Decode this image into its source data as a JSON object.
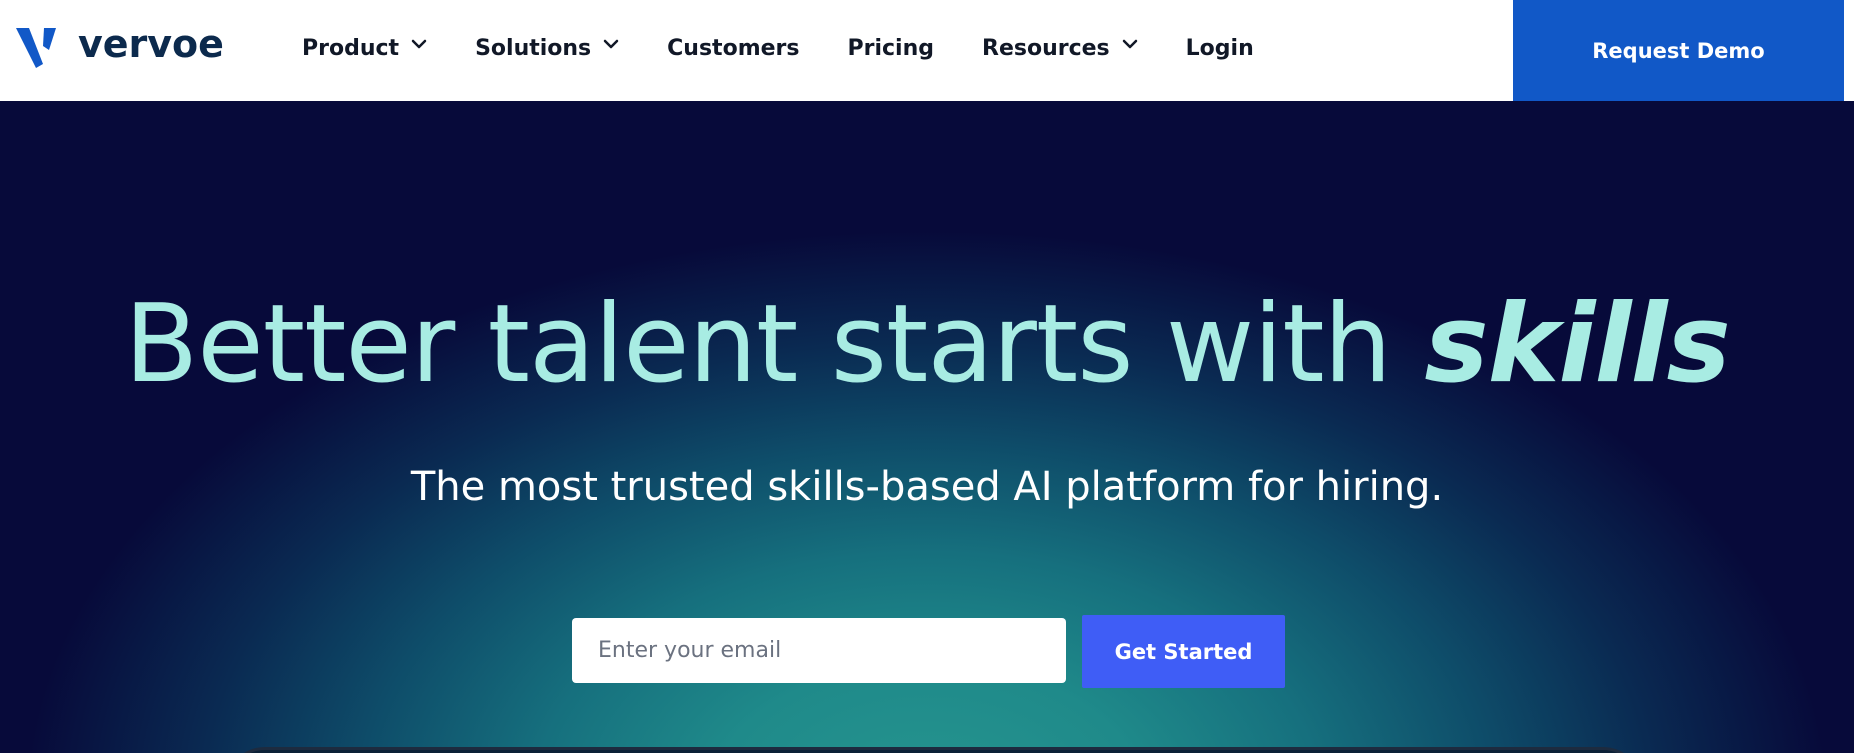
{
  "brand": {
    "name": "vervoe",
    "logo_color": "#1158c7",
    "text_color": "#0c2a4d"
  },
  "nav": {
    "items": [
      {
        "label": "Product",
        "has_dropdown": true
      },
      {
        "label": "Solutions",
        "has_dropdown": true
      },
      {
        "label": "Customers",
        "has_dropdown": false
      },
      {
        "label": "Pricing",
        "has_dropdown": false
      },
      {
        "label": "Resources",
        "has_dropdown": true
      },
      {
        "label": "Login",
        "has_dropdown": false
      }
    ],
    "cta_label": "Request Demo",
    "cta_color": "#1158c7"
  },
  "hero": {
    "headline_main": "Better talent starts with ",
    "headline_emphasis": "skills",
    "subheadline": "The most trusted skills-based AI platform for hiring.",
    "email_placeholder": "Enter your email",
    "email_value": "",
    "cta_label": "Get Started",
    "cta_color": "#3f5df6",
    "headline_color": "#a8ece3",
    "background_color": "#070a3a"
  },
  "icons": {
    "dropdown": "chevron-down-icon",
    "logo": "vervoe-logo-icon"
  }
}
